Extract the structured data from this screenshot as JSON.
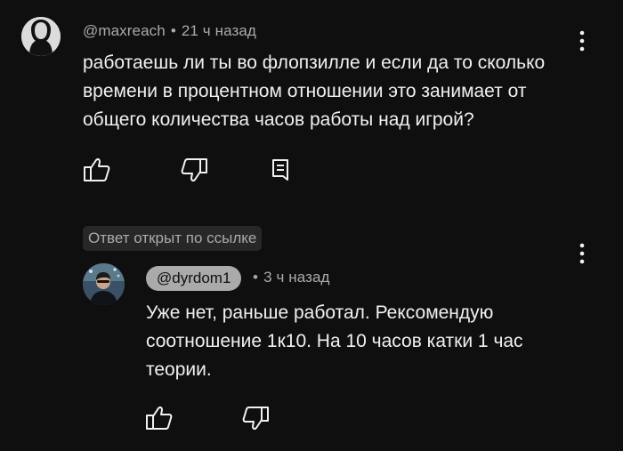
{
  "comment": {
    "author": "@maxreach",
    "separator": "•",
    "time": "21 ч назад",
    "text": "работаешь ли ты во флопзилле и если да то сколько времени в процентном отношении это занимает от общего количества часов работы над игрой?",
    "avatar_icon": "user-silhouette-icon",
    "actions": [
      "like-icon",
      "dislike-icon",
      "reply-icon"
    ]
  },
  "linked_badge": "Ответ открыт по ссылке",
  "reply": {
    "author": "@dyrdom1",
    "separator": "•",
    "time": "3 ч назад",
    "text": "Уже нет, раньше работал. Рексомендую соотношение 1к10. На 10 часов катки 1 час теории.",
    "avatar_icon": "user-photo-avatar",
    "actions": [
      "like-icon",
      "dislike-icon"
    ]
  },
  "colors": {
    "background": "#0f0f0f",
    "primary_text": "#f1f1f1",
    "secondary_text": "#aaaaaa",
    "badge_bg": "#272727",
    "handle_chip_bg": "#aaaaaa"
  }
}
